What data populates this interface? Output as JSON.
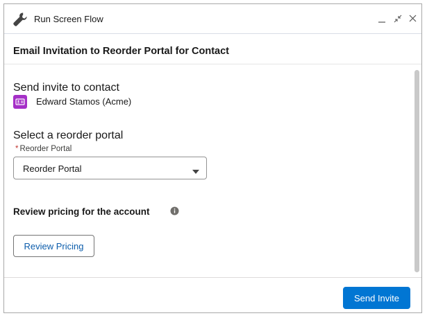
{
  "window": {
    "title": "Run Screen Flow",
    "title_icon": "wrench-icon",
    "controls": [
      "minimize-icon",
      "restore-icon",
      "close-icon"
    ]
  },
  "flow": {
    "heading": "Email Invitation to Reorder Portal for Contact"
  },
  "contact_section": {
    "title": "Send invite to contact",
    "contact_icon": "contact-card-icon",
    "contact_name": "Edward Stamos (Acme)"
  },
  "portal_section": {
    "title": "Select a reorder portal",
    "required_marker": "*",
    "field_label": "Reorder Portal",
    "selected_value": "Reorder Portal"
  },
  "pricing_section": {
    "title": "Review pricing for the account",
    "info_icon": "info-icon",
    "button_label": "Review Pricing"
  },
  "footer": {
    "send_button_label": "Send Invite"
  },
  "colors": {
    "brand": "#0176d3",
    "contact_icon_bg": "#a530c7",
    "required": "#c23934",
    "link_text": "#0b5cab"
  }
}
